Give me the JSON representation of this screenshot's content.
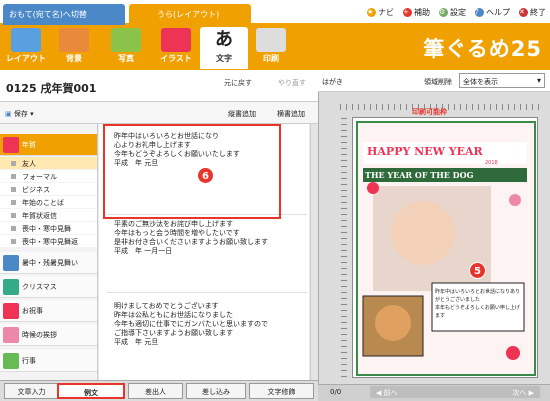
{
  "tabs": {
    "omote": "おもて(宛て名)へ切替",
    "ura": "うら(レイアウト)"
  },
  "menu": {
    "navi": "ナビ",
    "hosoku": "補助",
    "settings": "設定",
    "help": "ヘルプ",
    "exit": "終了"
  },
  "toolbar": {
    "layout": "レイアウト",
    "background": "背景",
    "photo": "写真",
    "illust": "イラスト",
    "text": "文字",
    "print": "印刷",
    "brand": "筆ぐるめ25"
  },
  "header": {
    "title": "0125 戌年賀001",
    "undo": "元に戻す",
    "redo": "やり直す",
    "save": "保存",
    "vertical_add": "縦書追加",
    "horizontal_add": "横書追加"
  },
  "categories": {
    "nenga": "年賀",
    "subs": [
      "友人",
      "フォーマル",
      "ビジネス",
      "年始のことば",
      "年賀状返信",
      "喪中・寒中見舞",
      "喪中・寒中見舞返"
    ],
    "shochu": "暑中・残暑見舞い",
    "christmas": "クリスマス",
    "celebration": "お祝事",
    "seasonal": "時候の挨拶",
    "events": "行事"
  },
  "examples": [
    "昨年中はいろいろとお世話になり\n心よりお礼申し上げます\n今年もどうぞよろしくお願いいたします\n平成　年 元旦",
    "平素のご無沙汰をお詫び申し上げます\n今年はもっと会う時間を増やしたいです\n是非お付き合いくださいますようお願い致します\n平成　年 一月一日",
    "明けましておめでとうございます\n昨年は公私ともにお世話になりました\n今年も適切に仕事でにガンバたいと思いますので\nご指導下さいますようお願い致します\n平成　年 元旦"
  ],
  "bottom_tabs": [
    "文章入力",
    "例文",
    "差出人",
    "差し込み",
    "文字修飾"
  ],
  "badges": {
    "six": "6",
    "five": "5"
  },
  "right": {
    "hagaki": "はがき",
    "area_label": "領域削除",
    "view_select": "全体を表示",
    "print_ok": "印刷可能枠",
    "page": "0/0",
    "prev": "◀ 前へ",
    "next": "次へ ▶"
  },
  "card": {
    "happy": "HAPPY NEW YEAR",
    "year_of_dog": "THE YEAR OF THE DOG",
    "year_num": "2018",
    "message": "昨年中はいろいろとお世話になりありがとうございました\n本年もどうぞよろしくお願い申し上げます"
  },
  "colors": {
    "accent": "#f0a000",
    "tab_blue": "#4a88c8",
    "highlight_red": "#e8352c"
  }
}
